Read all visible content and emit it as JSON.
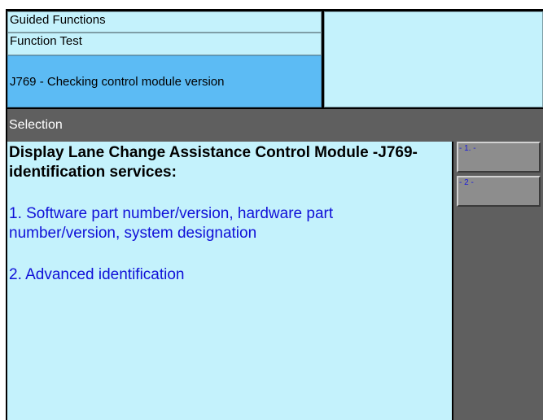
{
  "header": {
    "line1": "Guided Functions",
    "line2": "Function Test",
    "line3": "J769 - Checking control module version"
  },
  "selection": {
    "label": "Selection"
  },
  "content": {
    "title": "Display Lane Change Assistance Control Module -J769- identification services:",
    "items": [
      "1. Software part number/version, hardware part number/version, system designation",
      "2. Advanced identification"
    ]
  },
  "side_buttons": [
    {
      "label": "- 1. -"
    },
    {
      "label": "- 2 -"
    }
  ],
  "colors": {
    "header_bg": "#c4f2fc",
    "active_header_bg": "#5cbbf4",
    "selection_bar_bg": "#5f5f5f",
    "content_bg": "#c4f2fc",
    "item_text": "#1010d8",
    "button_bg": "#8d8d8d"
  }
}
